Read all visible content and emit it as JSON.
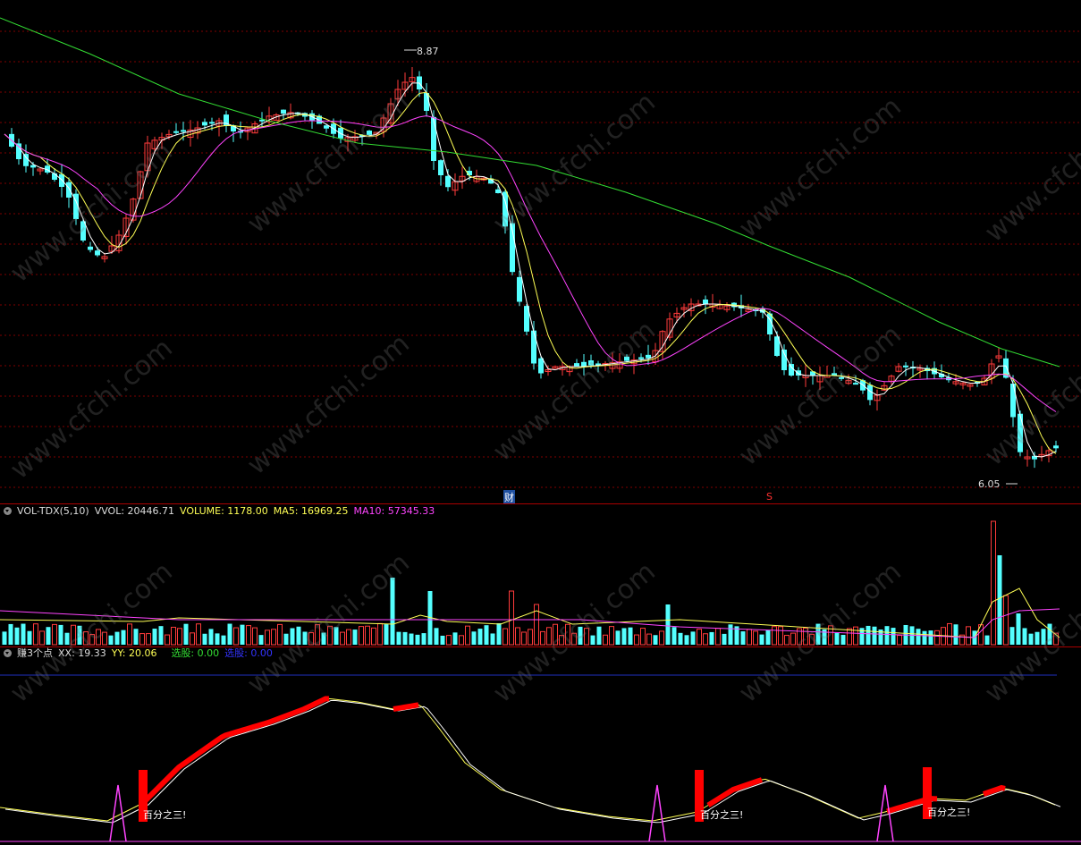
{
  "price_panel": {
    "high_label": "8.87",
    "low_label": "6.05",
    "marker_cai": "财",
    "marker_s": "S"
  },
  "volume_panel": {
    "indicator_name": "VOL-TDX(5,10)",
    "vvol": "VVOL: 20446.71",
    "volume": "VOLUME: 1178.00",
    "ma5": "MA5: 16969.25",
    "ma10": "MA10: 57345.33"
  },
  "indicator_panel": {
    "indicator_name": "赚3个点",
    "xx": "XX: 19.33",
    "yy": "YY: 20.06",
    "xuangu1": "选股: 0.00",
    "xuangu2": "选股: 0.00",
    "signal_label": "百分之三!"
  },
  "watermark": "www.cfchi.com",
  "colors": {
    "up": "#ff3b3b",
    "down": "#54ffff",
    "ma5": "#ffffff",
    "ma10": "#ffff55",
    "ma20": "#ff44ff",
    "ma60": "#33dd33",
    "grid": "#800000",
    "signal": "#ff0000"
  },
  "chart_data": {
    "type": "candlestick",
    "high": 8.87,
    "low": 6.05
  }
}
